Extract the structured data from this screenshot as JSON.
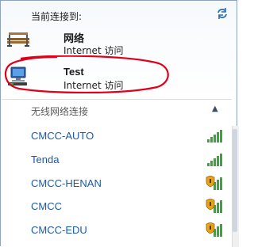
{
  "header": {
    "title": "当前连接到:"
  },
  "connections": [
    {
      "name": "网络",
      "status": "Internet 访问",
      "icon": "bench-network-icon"
    },
    {
      "name": "Test",
      "status": "Internet 访问",
      "icon": "computer-network-icon"
    }
  ],
  "wireless": {
    "section_title": "无线网络连接",
    "networks": [
      {
        "name": "CMCC-AUTO",
        "secured": false,
        "signal_bars": 5
      },
      {
        "name": "Tenda",
        "secured": false,
        "signal_bars": 5
      },
      {
        "name": "CMCC-HENAN",
        "secured": true,
        "signal_bars": 5
      },
      {
        "name": "CMCC",
        "secured": true,
        "signal_bars": 5
      },
      {
        "name": "CMCC-EDU",
        "secured": true,
        "signal_bars": 5
      }
    ]
  },
  "colors": {
    "link": "#1a5aa8",
    "signal": "#3aa53a",
    "annotation": "#e0001a"
  }
}
